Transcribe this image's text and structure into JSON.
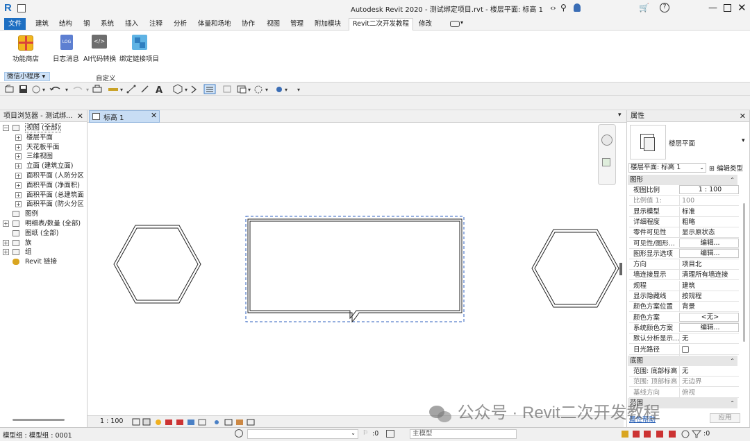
{
  "title": {
    "app_text": "Autodesk Revit 2020 - 测试绑定项目.rvt - 楼层平面: 标高 1"
  },
  "tabs": [
    "文件",
    "建筑",
    "结构",
    "钢",
    "系统",
    "插入",
    "注释",
    "分析",
    "体量和场地",
    "协作",
    "视图",
    "管理",
    "附加模块",
    "Revit二次开发教程",
    "修改"
  ],
  "ribbon": {
    "buttons": [
      {
        "label": "功能商店"
      },
      {
        "label": "日志消息"
      },
      {
        "label": "AI代码转换"
      },
      {
        "label": "绑定链接项目"
      }
    ],
    "panel_title_left": "微信小程序",
    "panel_title_right": "自定义"
  },
  "browser": {
    "title": "项目浏览器 - 测试绑...",
    "items": [
      {
        "label": "视图 (全部)",
        "level": 0,
        "toggle": "−"
      },
      {
        "label": "楼层平面",
        "level": 1,
        "toggle": "+"
      },
      {
        "label": "天花板平面",
        "level": 1,
        "toggle": "+"
      },
      {
        "label": "三维视图",
        "level": 1,
        "toggle": "+"
      },
      {
        "label": "立面 (建筑立面)",
        "level": 1,
        "toggle": "+"
      },
      {
        "label": "面积平面 (人防分区",
        "level": 1,
        "toggle": "+"
      },
      {
        "label": "面积平面 (净面积)",
        "level": 1,
        "toggle": "+"
      },
      {
        "label": "面积平面 (总建筑面",
        "level": 1,
        "toggle": "+"
      },
      {
        "label": "面积平面 (防火分区",
        "level": 1,
        "toggle": "+"
      },
      {
        "label": "图例",
        "level": 0,
        "toggle": ""
      },
      {
        "label": "明细表/数量 (全部)",
        "level": 0,
        "toggle": "+"
      },
      {
        "label": "图纸 (全部)",
        "level": 0,
        "toggle": ""
      },
      {
        "label": "族",
        "level": 0,
        "toggle": "+"
      },
      {
        "label": "组",
        "level": 0,
        "toggle": "+"
      },
      {
        "label": "Revit 链接",
        "level": 0,
        "toggle": ""
      }
    ]
  },
  "view_tab": {
    "label": "标高 1"
  },
  "view_bar": {
    "scale": "1 : 100"
  },
  "properties": {
    "title": "属性",
    "type_name": "楼层平面",
    "selector": "楼层平面: 标高 1",
    "edit_type": "编辑类型",
    "group_graphics": "图形",
    "rows": [
      {
        "k": "视图比例",
        "v": "1 : 100",
        "box": true
      },
      {
        "k": "比例值 1:",
        "v": "100",
        "dim": true
      },
      {
        "k": "显示模型",
        "v": "标准"
      },
      {
        "k": "详细程度",
        "v": "粗略"
      },
      {
        "k": "零件可见性",
        "v": "显示原状态"
      },
      {
        "k": "可见性/图形...",
        "v": "编辑...",
        "box": true
      },
      {
        "k": "图形显示选项",
        "v": "编辑...",
        "box": true
      },
      {
        "k": "方向",
        "v": "项目北"
      },
      {
        "k": "墙连接显示",
        "v": "清理所有墙连接"
      },
      {
        "k": "规程",
        "v": "建筑"
      },
      {
        "k": "显示隐藏线",
        "v": "按规程"
      },
      {
        "k": "颜色方案位置",
        "v": "背景"
      },
      {
        "k": "颜色方案",
        "v": "<无>",
        "box": true
      },
      {
        "k": "系统颜色方案",
        "v": "编辑...",
        "box": true
      },
      {
        "k": "默认分析显示...",
        "v": "无"
      },
      {
        "k": "日光路径",
        "v": "",
        "check": true
      }
    ],
    "group_underlay": "底图",
    "rows2": [
      {
        "k": "范围: 底部标高",
        "v": "无"
      },
      {
        "k": "范围: 顶部标高",
        "v": "无边界",
        "dim": true
      },
      {
        "k": "基线方向",
        "v": "俯视",
        "dim": true
      }
    ],
    "group_extents": "范围",
    "help_link": "属性帮助",
    "apply": "应用"
  },
  "status": {
    "left": "模型组 : 模型组 : 0001",
    "count": ":0",
    "model": "主模型",
    "filter_count": ":0"
  },
  "watermark": "公众号 · Revit二次开发教程"
}
